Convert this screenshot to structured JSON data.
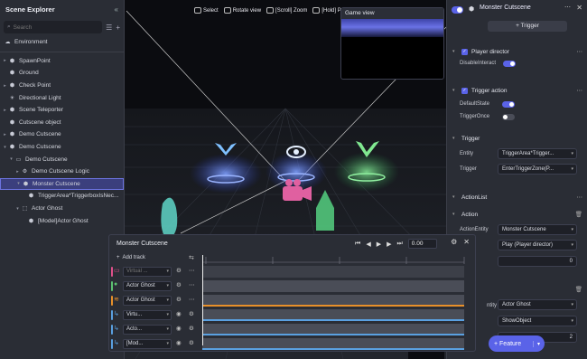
{
  "toolbar": {
    "select": "Select",
    "rotate": "Rotate view",
    "zoom": "[Scroll] Zoom",
    "hold": "[Hold] Pa"
  },
  "explorer": {
    "title": "Scene Explorer",
    "search_placeholder": "Search",
    "root": "Environment",
    "items": [
      {
        "label": "SpawnPoint"
      },
      {
        "label": "Ground"
      },
      {
        "label": "Check Point"
      },
      {
        "label": "Directional Light"
      },
      {
        "label": "Scene Teleporter"
      },
      {
        "label": "Cutscene object"
      },
      {
        "label": "Demo Cutscene"
      },
      {
        "label": "Demo Cutscene"
      },
      {
        "label": "Demo Cutscene"
      },
      {
        "label": "Demo Cutscene Logic"
      },
      {
        "label": "Monster Cutscene"
      },
      {
        "label": "TriggerArea*TriggerboxIsNec..."
      },
      {
        "label": "Actor Ghost"
      },
      {
        "label": "[Model]Actor Ghost"
      }
    ]
  },
  "gameview": {
    "title": "Game view"
  },
  "inspector": {
    "title": "Monster Cutscene",
    "trigger_btn": "+ Trigger",
    "player_director": "Player director",
    "disable_interact": "DisableInteract",
    "trigger_action": "Trigger action",
    "default_state": "DefaultState",
    "trigger_once": "TriggerOnce",
    "trigger_section": "Trigger",
    "entity_label": "Entity",
    "entity_value": "TriggerArea*Trigger...",
    "trigger_label": "Trigger",
    "trigger_value": "EnterTriggerZone(P...",
    "action_list": "ActionList",
    "action": "Action",
    "action_entity_label": "ActionEntity",
    "action_entity_value": "Monster Cutscene",
    "action2_value": "Play (Player director)",
    "num1": "0",
    "entity2_label": "ntity",
    "entity2_value": "Actor Ghost",
    "show_object": "ShowObject",
    "num2": "2",
    "feature_btn": "+ Feature"
  },
  "timeline": {
    "title": "Monster Cutscene",
    "time": "0.00",
    "add_track": "Add track",
    "tracks": [
      {
        "label": "Virtual ...",
        "color": "#e0508a"
      },
      {
        "label": "Actor Ghost",
        "color": "#5cc070"
      },
      {
        "label": "Actor Ghost",
        "color": "#e8902a"
      },
      {
        "label": "Virtu...",
        "color": "#5aa0e0"
      },
      {
        "label": "Acto...",
        "color": "#5aa0e0"
      },
      {
        "label": "[Mod...",
        "color": "#5aa0e0"
      }
    ]
  }
}
